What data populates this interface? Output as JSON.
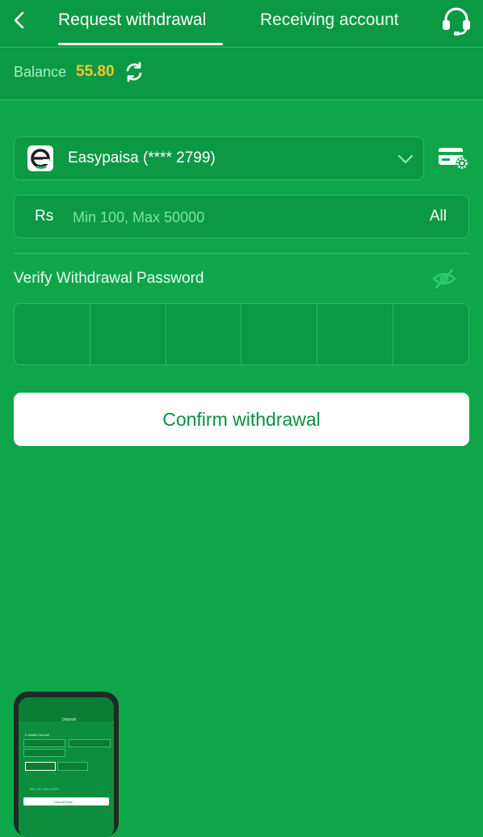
{
  "header": {
    "tabs": [
      {
        "label": "Request withdrawal",
        "active": true
      },
      {
        "label": "Receiving account",
        "active": false
      }
    ],
    "icons": {
      "back": "chevron-left-icon",
      "support": "headset-icon"
    }
  },
  "balance": {
    "label": "Balance",
    "value": "55.80",
    "value_color": "#f7c531",
    "refresh_icon": "refresh-icon"
  },
  "account": {
    "label": "Easypaisa (**** 2799)",
    "logo_icon": "easypaisa-logo-icon",
    "dropdown_icon": "chevron-down-icon",
    "settings_icon": "card-settings-icon"
  },
  "amount": {
    "currency": "Rs",
    "placeholder": "Min 100, Max 50000",
    "value": "",
    "all_label": "All"
  },
  "password": {
    "label": "Verify Withdrawal Password",
    "visibility_icon": "eye-off-icon",
    "digits": [
      "",
      "",
      "",
      "",
      "",
      ""
    ]
  },
  "confirm_label": "Confirm withdrawal",
  "preview": {
    "title": "Deposit",
    "tab_label": "E-Wallet Deposit",
    "button_label": "Deposit Now",
    "amount_hint": "Min 100, Max 50000"
  },
  "colors": {
    "background": "#0fa64a",
    "panel": "#0b9a43",
    "border": "#2cbb63",
    "button_text": "#0a8f3e"
  }
}
